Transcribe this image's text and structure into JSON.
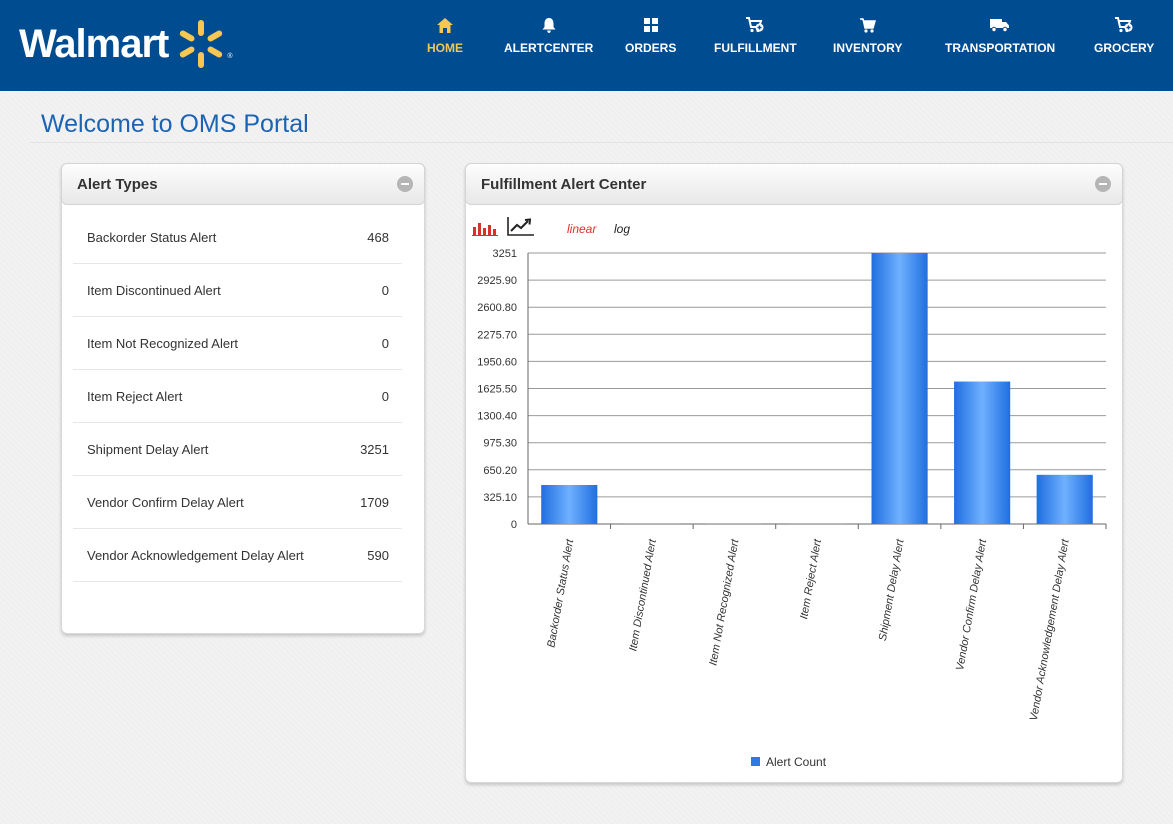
{
  "header": {
    "brand": "Walmart",
    "nav": [
      {
        "label": "HOME",
        "icon": "home-icon",
        "active": true
      },
      {
        "label": "ALERTCENTER",
        "icon": "bell-icon",
        "active": false
      },
      {
        "label": "ORDERS",
        "icon": "grid-icon",
        "active": false
      },
      {
        "label": "FULFILLMENT",
        "icon": "cart-add-icon",
        "active": false
      },
      {
        "label": "INVENTORY",
        "icon": "cart-icon",
        "active": false
      },
      {
        "label": "TRANSPORTATION",
        "icon": "truck-icon",
        "active": false
      },
      {
        "label": "GROCERY",
        "icon": "cart-add-icon",
        "active": false
      }
    ],
    "active_color": "#f7c653",
    "bar_color": "#004c91"
  },
  "page": {
    "title": "Welcome to OMS Portal"
  },
  "alert_types": {
    "title": "Alert Types",
    "rows": [
      {
        "label": "Backorder Status Alert",
        "count": "468"
      },
      {
        "label": "Item Discontinued Alert",
        "count": "0"
      },
      {
        "label": "Item Not Recognized Alert",
        "count": "0"
      },
      {
        "label": "Item Reject Alert",
        "count": "0"
      },
      {
        "label": "Shipment Delay Alert",
        "count": "3251"
      },
      {
        "label": "Vendor Confirm Delay Alert",
        "count": "1709"
      },
      {
        "label": "Vendor Acknowledgement Delay Alert",
        "count": "590"
      }
    ]
  },
  "fulfillment": {
    "title": "Fulfillment Alert Center",
    "scale_options": {
      "linear": "linear",
      "log": "log"
    },
    "selected_scale": "linear",
    "linear_color": "#d9302c"
  },
  "chart_data": {
    "type": "bar",
    "categories": [
      "Backorder Status Alert",
      "Item Discontinued Alert",
      "Item Not Recognized Alert",
      "Item Reject Alert",
      "Shipment Delay Alert",
      "Vendor Confirm Delay Alert",
      "Vendor Acknowledgement Delay Alert"
    ],
    "series": [
      {
        "name": "Alert Count",
        "values": [
          468,
          0,
          0,
          0,
          3251,
          1709,
          590
        ],
        "color": "#2a7be6"
      }
    ],
    "y_ticks": [
      "0",
      "325.10",
      "650.20",
      "975.30",
      "1300.40",
      "1625.50",
      "1950.60",
      "2275.70",
      "2600.80",
      "2925.90",
      "3251"
    ],
    "ylim": [
      0,
      3251
    ],
    "grid": true,
    "legend_position": "bottom-center"
  }
}
